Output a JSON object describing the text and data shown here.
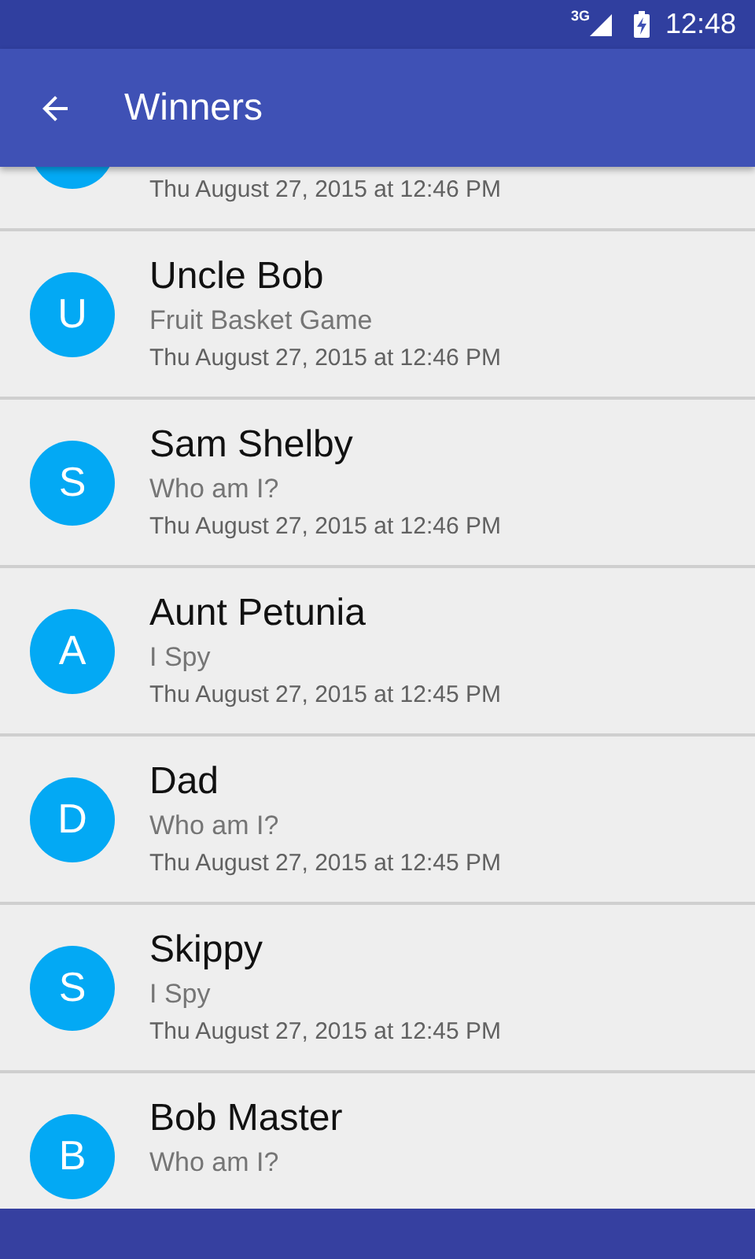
{
  "status_bar": {
    "network": "3G",
    "time": "12:48"
  },
  "app_bar": {
    "title": "Winners"
  },
  "winners": [
    {
      "date": "Thu August 27, 2015 at 12:46 PM"
    },
    {
      "initial": "U",
      "name": "Uncle Bob",
      "game": "Fruit Basket Game",
      "date": "Thu August 27, 2015 at 12:46 PM"
    },
    {
      "initial": "S",
      "name": "Sam Shelby",
      "game": "Who am I?",
      "date": "Thu August 27, 2015 at 12:46 PM"
    },
    {
      "initial": "A",
      "name": "Aunt Petunia",
      "game": "I Spy",
      "date": "Thu August 27, 2015 at 12:45 PM"
    },
    {
      "initial": "D",
      "name": "Dad",
      "game": "Who am I?",
      "date": "Thu August 27, 2015 at 12:45 PM"
    },
    {
      "initial": "S",
      "name": "Skippy",
      "game": "I Spy",
      "date": "Thu August 27, 2015 at 12:45 PM"
    },
    {
      "initial": "B",
      "name": "Bob Master",
      "game": "Who am I?"
    }
  ]
}
